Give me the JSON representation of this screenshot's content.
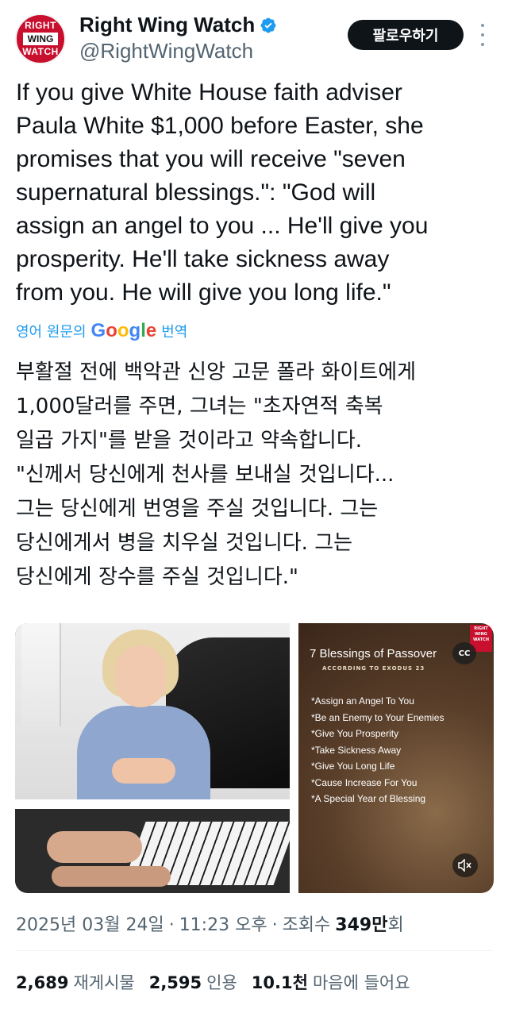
{
  "author": {
    "avatar_lines": [
      "RIGHT",
      "WING",
      "WATCH"
    ],
    "display_name": "Right Wing Watch",
    "handle": "@RightWingWatch",
    "verified": true
  },
  "actions": {
    "follow_label": "팔로우하기",
    "more_icon": "more-vertical-icon"
  },
  "tweet": {
    "text": "If you give White House faith adviser\nPaula White $1,000 before Easter, she\npromises that you will receive \"seven\nsupernatural blessings.\": \"God will\nassign an angel to you ... He'll give you\nprosperity. He'll take sickness away\nfrom you. He will give you long life.\"",
    "translate_prefix": "영어 원문의",
    "translate_brand": "Google",
    "translate_suffix": "번역",
    "translated_text": "부활절 전에 백악관 신앙 고문 폴라 화이트에게\n1,000달러를 주면, 그녀는 \"초자연적 축복\n일곱 가지\"를 받을 것이라고 약속합니다.\n\"신께서 당신에게 천사를 보내실 것입니다...\n그는 당신에게 번영을 주실 것입니다. 그는\n당신에게서 병을 치우실 것입니다. 그는\n당신에게 장수를 주실 것입니다.\""
  },
  "media": {
    "right_logo": "RIGHT WING WATCH",
    "cc_label": "CC",
    "title": "7 Blessings of Passover",
    "subtitle": "ACCORDING TO EXODUS 23",
    "blessings": [
      "*Assign an Angel To You",
      "*Be an Enemy to Your Enemies",
      "*Give You Prosperity",
      "*Take Sickness Away",
      "*Give You Long Life",
      "*Cause Increase For You",
      "*A Special Year of Blessing"
    ],
    "mute_icon": "muted-speaker-icon"
  },
  "meta": {
    "date": "2025년 03월 24일",
    "separator": "·",
    "time": "11:23 오후",
    "views_label": "조회수",
    "views_number": "349만",
    "views_suffix": "회"
  },
  "stats": {
    "reposts_count": "2,689",
    "reposts_label": "재게시물",
    "quotes_count": "2,595",
    "quotes_label": "인용",
    "likes_count": "10.1천",
    "likes_label": "마음에 들어요"
  },
  "colors": {
    "link_blue": "#1d9bf0",
    "text_primary": "#0f1419",
    "text_secondary": "#536471",
    "brand_red": "#c8102e"
  }
}
